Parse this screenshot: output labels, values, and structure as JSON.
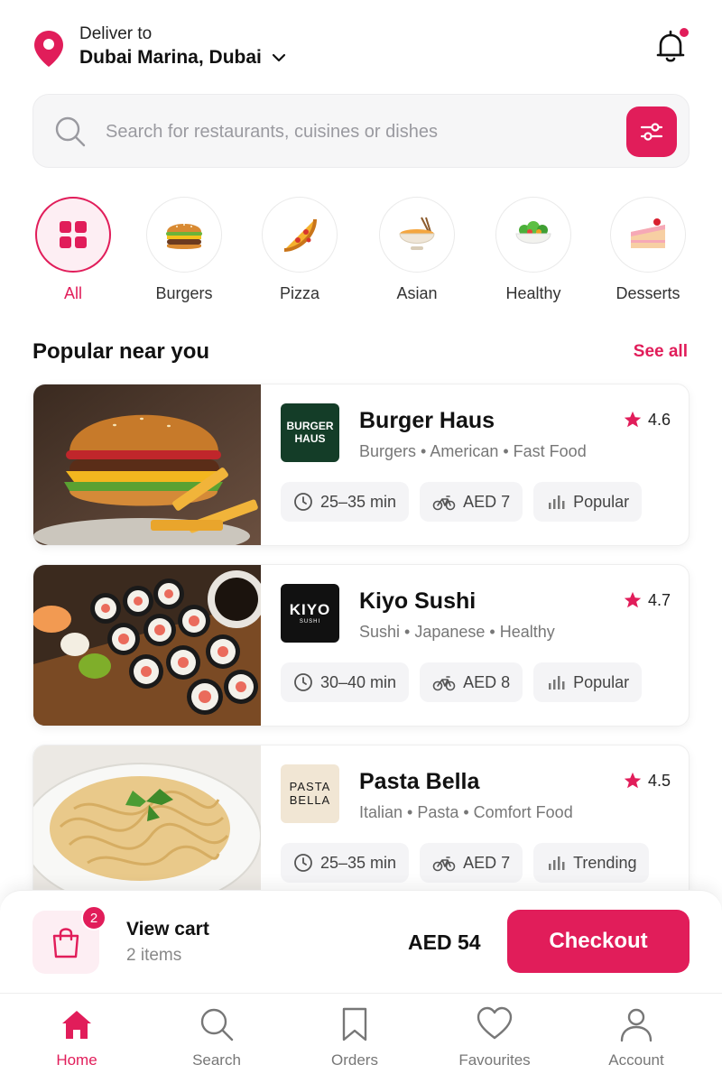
{
  "header": {
    "deliver_label": "Deliver to",
    "location": "Dubai Marina, Dubai",
    "pin_icon": "location-pin-icon",
    "chevron_icon": "chevron-down-icon",
    "bell_icon": "bell-icon",
    "has_notification": true
  },
  "search": {
    "placeholder": "Search for restaurants, cuisines or dishes",
    "value": "",
    "search_icon": "search-icon",
    "filter_icon": "sliders-icon"
  },
  "categories": [
    {
      "label": "All",
      "icon": "grid-icon",
      "active": true
    },
    {
      "label": "Burgers",
      "icon": "burger-icon",
      "active": false
    },
    {
      "label": "Pizza",
      "icon": "pizza-icon",
      "active": false
    },
    {
      "label": "Asian",
      "icon": "noodle-bowl-icon",
      "active": false
    },
    {
      "label": "Healthy",
      "icon": "salad-bowl-icon",
      "active": false
    },
    {
      "label": "Desserts",
      "icon": "cake-icon",
      "active": false
    }
  ],
  "section": {
    "title": "Popular near you",
    "see_all": "See all"
  },
  "restaurants": [
    {
      "name": "Burger Haus",
      "logo_lines": [
        "BURGER",
        "HAUS"
      ],
      "rating": "4.6",
      "tags": "Burgers • American • Fast Food",
      "time": "25–35 min",
      "fee": "AED 7",
      "badge": "Popular",
      "image": "burger-photo"
    },
    {
      "name": "Kiyo Sushi",
      "logo_lines": [
        "KIYO",
        "SUSHI"
      ],
      "rating": "4.7",
      "tags": "Sushi • Japanese • Healthy",
      "time": "30–40 min",
      "fee": "AED 8",
      "badge": "Popular",
      "image": "sushi-photo"
    },
    {
      "name": "Pasta Bella",
      "logo_lines": [
        "PASTA",
        "BELLA"
      ],
      "rating": "4.5",
      "tags": "Italian • Pasta • Comfort Food",
      "time": "25–35 min",
      "fee": "AED 7",
      "badge": "Trending",
      "image": "pasta-photo"
    }
  ],
  "cart": {
    "count": "2",
    "title": "View cart",
    "subtitle": "2 items",
    "total": "AED 54",
    "checkout_label": "Checkout",
    "icon": "shopping-bag-icon"
  },
  "nav": [
    {
      "label": "Home",
      "icon": "home-icon",
      "active": true
    },
    {
      "label": "Search",
      "icon": "search-icon",
      "active": false
    },
    {
      "label": "Orders",
      "icon": "bookmark-icon",
      "active": false
    },
    {
      "label": "Favourites",
      "icon": "heart-icon",
      "active": false
    },
    {
      "label": "Account",
      "icon": "user-icon",
      "active": false
    }
  ],
  "colors": {
    "accent": "#e11d5a",
    "accent_tint": "#fdeef3",
    "text": "#111111",
    "muted": "#777777"
  }
}
